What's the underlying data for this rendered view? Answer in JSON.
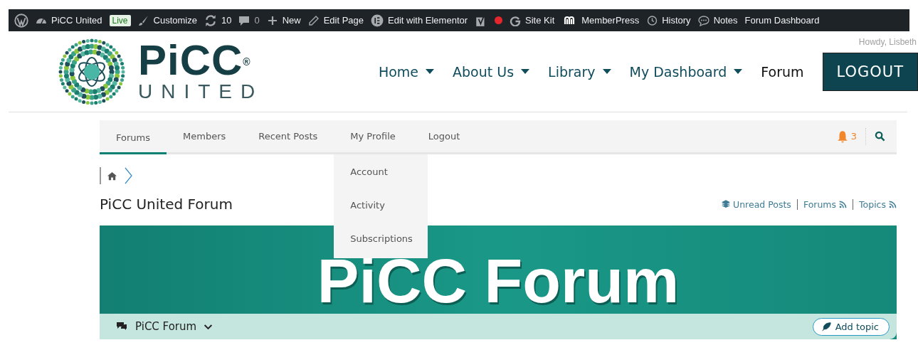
{
  "admin_bar": {
    "items": [
      {
        "kind": "wordpress"
      },
      {
        "kind": "dashboard",
        "label": "PiCC United"
      },
      {
        "kind": "badge",
        "label": "Live"
      },
      {
        "kind": "brush",
        "label": "Customize"
      },
      {
        "kind": "updates",
        "label": "10"
      },
      {
        "kind": "comments",
        "label": "0"
      },
      {
        "kind": "plus",
        "label": "New"
      },
      {
        "kind": "pencil",
        "label": "Edit Page"
      },
      {
        "kind": "elementor",
        "label": "Edit with Elementor"
      },
      {
        "kind": "yoast"
      },
      {
        "kind": "status-dot",
        "color": "#e5262d"
      },
      {
        "kind": "google",
        "label": "Site Kit"
      },
      {
        "kind": "memberpress",
        "label": "MemberPress"
      },
      {
        "kind": "history",
        "label": "History"
      },
      {
        "kind": "notes",
        "label": "Notes"
      },
      {
        "kind": "text",
        "label": "Forum Dashboard"
      }
    ],
    "greeting": "Howdy, Lisbeth"
  },
  "header": {
    "logo": {
      "name": "PiCC$^{®}$",
      "subtitle": "UNITED"
    },
    "nav": [
      {
        "label": "Home",
        "has_menu": true
      },
      {
        "label": "About Us",
        "has_menu": true
      },
      {
        "label": "Library",
        "has_menu": true
      },
      {
        "label": "My Dashboard",
        "has_menu": true
      },
      {
        "label": "Forum",
        "has_menu": false
      }
    ],
    "logout_button": "LOGOUT"
  },
  "forum_nav": {
    "tabs": [
      {
        "label": "Forums",
        "selected": true
      },
      {
        "label": "Members",
        "selected": false
      },
      {
        "label": "Recent Posts",
        "selected": false
      },
      {
        "label": "My Profile",
        "selected": false,
        "submenu": [
          "Account",
          "Activity",
          "Subscriptions"
        ]
      },
      {
        "label": "Logout",
        "selected": false
      }
    ],
    "notifications": "3"
  },
  "page_title": "PiCC United Forum",
  "links": [
    {
      "label": "Unread Posts",
      "kind": "unread-posts"
    },
    {
      "label": "Forums",
      "kind": "forums-feed"
    },
    {
      "label": "Topics",
      "kind": "topics-feed"
    }
  ],
  "banner": {
    "title": "PiCC Forum",
    "forum_selector": "PiCC Forum",
    "add_topic": "Add topic"
  }
}
